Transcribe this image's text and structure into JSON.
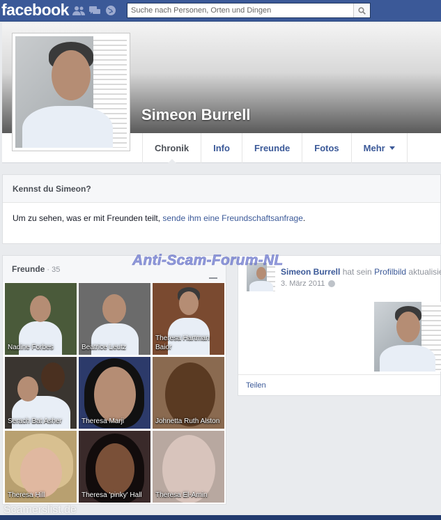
{
  "topbar": {
    "logo": "facebook",
    "search_placeholder": "Suche nach Personen, Orten und Dingen"
  },
  "profile": {
    "name": "Simeon Burrell",
    "tabs": [
      {
        "label": "Chronik"
      },
      {
        "label": "Info"
      },
      {
        "label": "Freunde"
      },
      {
        "label": "Fotos"
      },
      {
        "label": "Mehr"
      }
    ]
  },
  "know": {
    "title": "Kennst du Simeon?",
    "text": "Um zu sehen, was er mit Freunden teilt, ",
    "link": "sende ihm eine Freundschaftsanfrage",
    "end": "."
  },
  "friends": {
    "title": "Freunde",
    "separator": " · ",
    "count": "35",
    "list": [
      {
        "name": "Nadine Forbes",
        "bg": "#4a5a3a"
      },
      {
        "name": "Beatrice Leutz",
        "bg": "#6b6b6b"
      },
      {
        "name": "Theresa Hartman Baior",
        "bg": "#7a4a30"
      },
      {
        "name": "Serach Bat Asher",
        "bg": "#3a3530"
      },
      {
        "name": "Theresa Marji",
        "bg": "#2c3a6a"
      },
      {
        "name": "Johnetta Ruth Alston",
        "bg": "#8a6a50"
      },
      {
        "name": "Theresa Hill",
        "bg": "#b8a070"
      },
      {
        "name": "Theresa 'pinky' Hall",
        "bg": "#3a2a2a"
      },
      {
        "name": "Theresa El-Amin",
        "bg": "#b8a8a0"
      }
    ]
  },
  "post": {
    "author": "Simeon Burrell",
    "action": " hat sein ",
    "link": "Profilbild",
    "suffix": " aktualisiert.",
    "date": "3. März 2011",
    "share": "Teilen"
  },
  "watermarks": {
    "main": "Anti-Scam-Forum-NL",
    "bottom": "Scamerslist.de"
  }
}
